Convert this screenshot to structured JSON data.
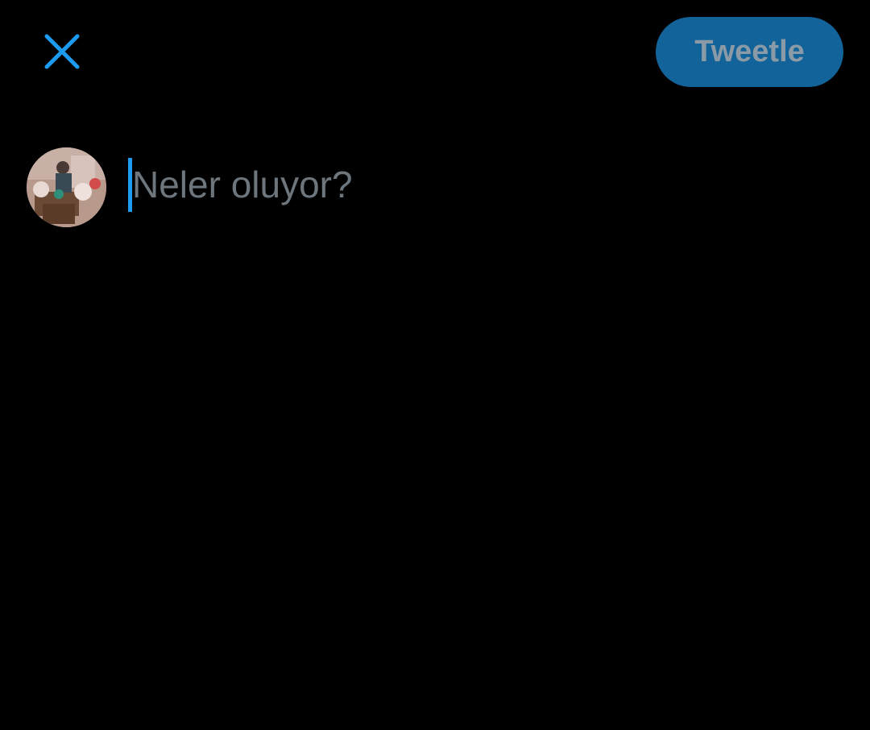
{
  "header": {
    "close_icon": "close-icon",
    "tweet_button_label": "Tweetle"
  },
  "composer": {
    "avatar_icon": "profile-avatar",
    "placeholder": "Neler oluyor?"
  },
  "colors": {
    "background": "#000000",
    "accent": "#1d9bf0",
    "button_disabled_bg": "#126399",
    "button_disabled_text": "#8a9aa6",
    "placeholder_text": "#6e767d"
  }
}
